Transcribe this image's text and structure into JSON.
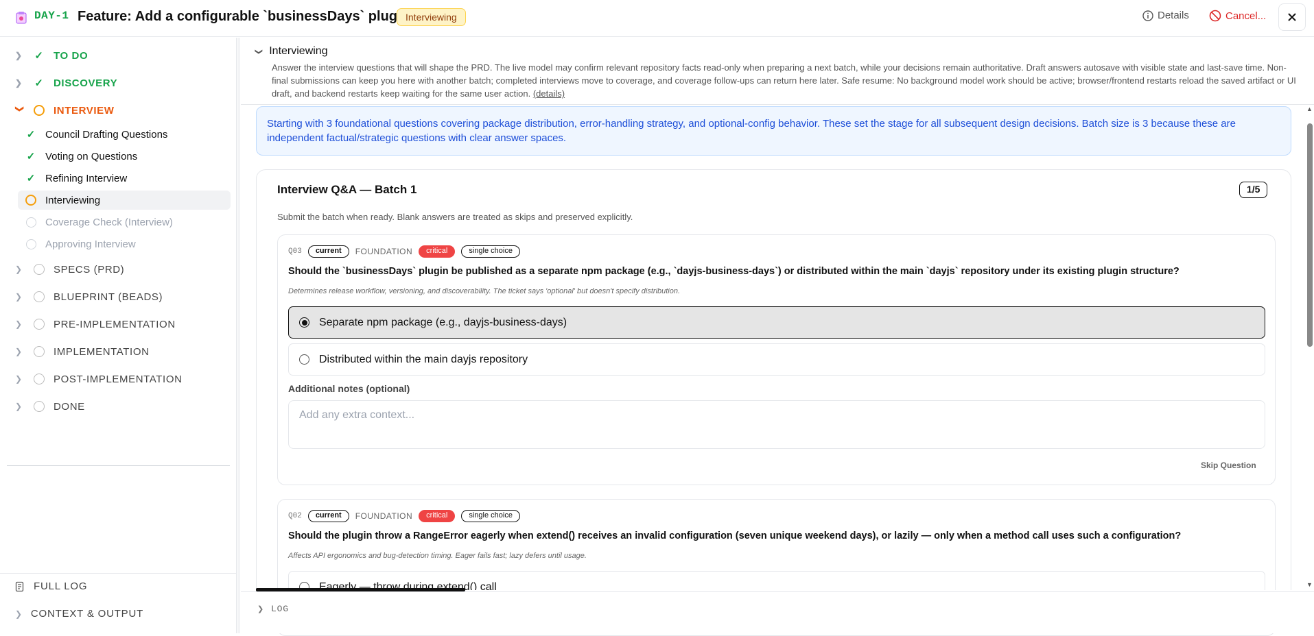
{
  "header": {
    "day": "DAY-1",
    "title": "Feature: Add a configurable `businessDays` plugin",
    "status": "Interviewing",
    "details_label": "Details",
    "cancel_label": "Cancel..."
  },
  "sidebar": {
    "phases_top": [
      {
        "label": "TO DO"
      },
      {
        "label": "DISCOVERY"
      },
      {
        "label": "INTERVIEW"
      }
    ],
    "interview_steps": [
      {
        "label": "Council Drafting Questions",
        "state": "done"
      },
      {
        "label": "Voting on Questions",
        "state": "done"
      },
      {
        "label": "Refining Interview",
        "state": "done"
      },
      {
        "label": "Interviewing",
        "state": "active"
      },
      {
        "label": "Coverage Check (Interview)",
        "state": "pending"
      },
      {
        "label": "Approving Interview",
        "state": "pending"
      }
    ],
    "phases_rest": [
      {
        "label": "SPECS (PRD)"
      },
      {
        "label": "BLUEPRINT (BEADS)"
      },
      {
        "label": "PRE-IMPLEMENTATION"
      },
      {
        "label": "IMPLEMENTATION"
      },
      {
        "label": "POST-IMPLEMENTATION"
      },
      {
        "label": "DONE"
      }
    ],
    "full_log": "FULL LOG",
    "context_output": "CONTEXT & OUTPUT"
  },
  "intro": {
    "title": "Interviewing",
    "text": "Answer the interview questions that will shape the PRD. The live model may confirm relevant repository facts read-only when preparing a next batch, while your decisions remain authoritative. Draft answers autosave with visible state and last-save time. Non-final submissions can keep you here with another batch; completed interviews move to coverage, and coverage follow-ups can return here later. Safe resume: No background model work should be active; browser/frontend restarts reload the saved artifact or UI draft, and backend restarts keep waiting for the same user action.",
    "details_link": "(details)"
  },
  "info": "Starting with 3 foundational questions covering package distribution, error-handling strategy, and optional-config behavior. These set the stage for all subsequent design decisions. Batch size is 3 because these are independent factual/strategic questions with clear answer spaces.",
  "batch": {
    "title": "Interview Q&A — Batch 1",
    "count": "1/5",
    "subtitle": "Submit the batch when ready. Blank answers are treated as skips and preserved explicitly."
  },
  "questions": [
    {
      "id": "Q03",
      "tag": "current",
      "category": "FOUNDATION",
      "priority": "critical",
      "kind": "single choice",
      "text": "Should the `businessDays` plugin be published as a separate npm package (e.g., `dayjs-business-days`) or distributed within the main `dayjs` repository under its existing plugin structure?",
      "hint": "Determines release workflow, versioning, and discoverability. The ticket says 'optional' but doesn't specify distribution.",
      "options": [
        {
          "label": "Separate npm package (e.g., dayjs-business-days)",
          "selected": true
        },
        {
          "label": "Distributed within the main dayjs repository",
          "selected": false
        }
      ],
      "notes_label": "Additional notes (optional)",
      "notes_placeholder": "Add any extra context...",
      "skip_label": "Skip Question"
    },
    {
      "id": "Q02",
      "tag": "current",
      "category": "FOUNDATION",
      "priority": "critical",
      "kind": "single choice",
      "text": "Should the plugin throw a RangeError eagerly when extend() receives an invalid configuration (seven unique weekend days), or lazily — only when a method call uses such a configuration?",
      "hint": "Affects API ergonomics and bug-detection timing. Eager fails fast; lazy defers until usage.",
      "options": [
        {
          "label": "Eagerly — throw during extend() call",
          "selected": false
        }
      ]
    }
  ],
  "log_label": "LOG",
  "colors": {
    "done": "#16a34a",
    "active": "#ea580c",
    "critical": "#ef4444",
    "info_text": "#1d4ed8",
    "status_bg": "#fef3c7"
  }
}
